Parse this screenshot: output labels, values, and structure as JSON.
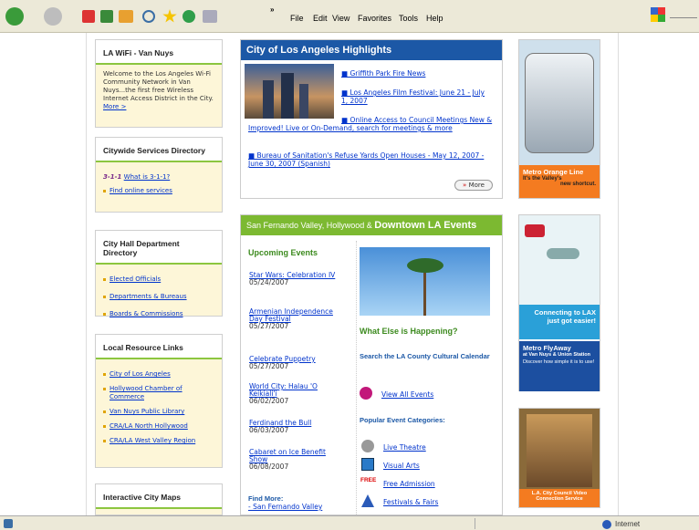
{
  "browser": {
    "menu": [
      "File",
      "Edit",
      "View",
      "Favorites",
      "Tools",
      "Help"
    ],
    "chevron": "»",
    "status_zone": "Internet"
  },
  "left": {
    "wifi": {
      "title": "LA WiFi - Van Nuys",
      "text": "Welcome to the Los Angeles Wi-Fi Community Network in Van Nuys...the first free Wireless Internet Access District in the City.",
      "more": "More >"
    },
    "citywide": {
      "title": "Citywide Services Directory",
      "logo": "3-1-1",
      "link1": "What is 3-1-1?",
      "link2": "Find online services"
    },
    "cityhall": {
      "title": "City Hall Department Directory",
      "items": [
        "Elected Officials",
        "Departments & Bureaus",
        "Boards & Commissions"
      ]
    },
    "local": {
      "title": "Local Resource Links",
      "items": [
        "City of Los Angeles",
        "Hollywood Chamber of Commerce",
        "Van Nuys Public Library",
        "CRA/LA North Hollywood",
        "CRA/LA West Valley Region"
      ]
    },
    "maps": {
      "title": "Interactive City Maps"
    }
  },
  "highlights": {
    "title": "City of Los Angeles Highlights",
    "items": [
      "Griffith Park Fire News",
      "Los Angeles Film Festival: June 21 - July 1, 2007",
      "Online Access to Council Meetings New & Improved! Live or On-Demand, search for meetings & more",
      "Bureau of Sanitation's Refuse Yards Open Houses - May 12, 2007 - June 30, 2007 (Spanish)"
    ],
    "more": "More",
    "more_arrow": "»"
  },
  "events": {
    "title_small": "San Fernando Valley, Hollywood &",
    "title_big": "Downtown LA Events",
    "upcoming": "Upcoming Events",
    "list": [
      {
        "t": "Star Wars: Celebration IV",
        "d": "05/24/2007"
      },
      {
        "t": "Armenian Independence Day Festival",
        "d": "05/27/2007"
      },
      {
        "t": "Celebrate Puppetry",
        "d": "05/27/2007"
      },
      {
        "t": "World City: Halau 'O Keikiali'i",
        "d": "06/02/2007"
      },
      {
        "t": "Ferdinand the Bull",
        "d": "06/03/2007"
      },
      {
        "t": "Cabaret on Ice Benefit Show",
        "d": "06/08/2007"
      }
    ],
    "find_more": "Find More:",
    "find_link": "- San Fernando Valley",
    "what_else": "What Else is Happening?",
    "search": "Search the LA County Cultural Calendar",
    "view_all": "View All Events",
    "popular": "Popular Event Categories:",
    "categories": [
      "Live Theatre",
      "Visual Arts",
      "Free Admission",
      "Festivals & Fairs"
    ],
    "free_label": "FREE"
  },
  "ads": {
    "orange": {
      "title": "Metro Orange Line",
      "sub": "It's the Valley's",
      "sub2": "new shortcut."
    },
    "lax": {
      "line1": "Connecting to LAX",
      "line2": "just got easier!",
      "title": "Metro FlyAway",
      "sub": "at Van Nuys & Union Station",
      "desc": "Discover how simple it is to use!"
    },
    "council": {
      "text": "L.A. City Council Video Connection Service"
    }
  },
  "colors": {
    "blue": "#1c58a6",
    "green": "#7cb931",
    "orange": "#f47b20",
    "cream": "#fdf6d8"
  }
}
